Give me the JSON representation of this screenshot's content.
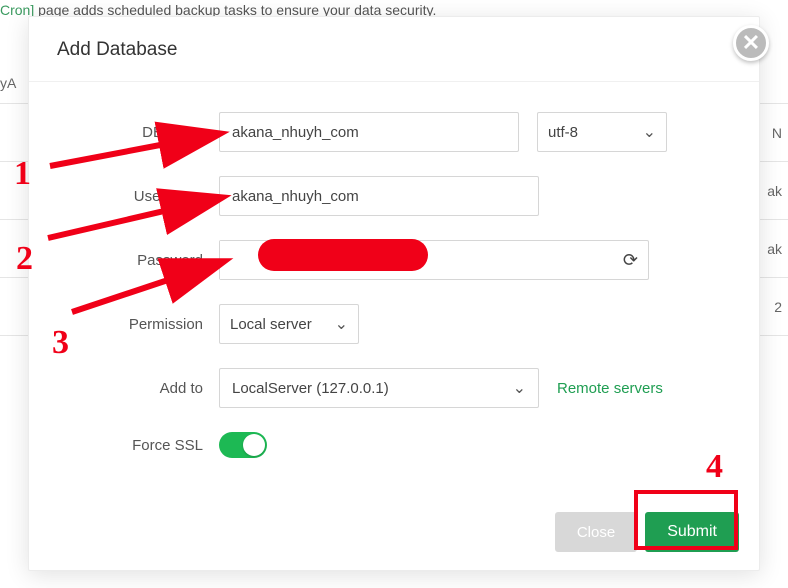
{
  "background": {
    "top_notice_prefix": "Cron]",
    "top_notice_rest": " page adds scheduled backup tasks to ensure your data security.",
    "row0_left": "yA",
    "row1_right": "N",
    "row2_right": "ak",
    "row3_right": "ak",
    "row4_right": "2"
  },
  "modal": {
    "title": "Add Database",
    "labels": {
      "dbname": "DBName",
      "username": "Username",
      "password": "Password",
      "permission": "Permission",
      "addto": "Add to",
      "forcessl": "Force SSL"
    },
    "values": {
      "dbname": "akana_nhuyh_com",
      "encoding": "utf-8",
      "username": "akana_nhuyh_com",
      "password": "",
      "permission": "Local server",
      "addto": "LocalServer (127.0.0.1)"
    },
    "remote_link": "Remote servers",
    "buttons": {
      "close": "Close",
      "submit": "Submit"
    }
  },
  "annotations": {
    "n1": "1",
    "n2": "2",
    "n3": "3",
    "n4": "4"
  }
}
